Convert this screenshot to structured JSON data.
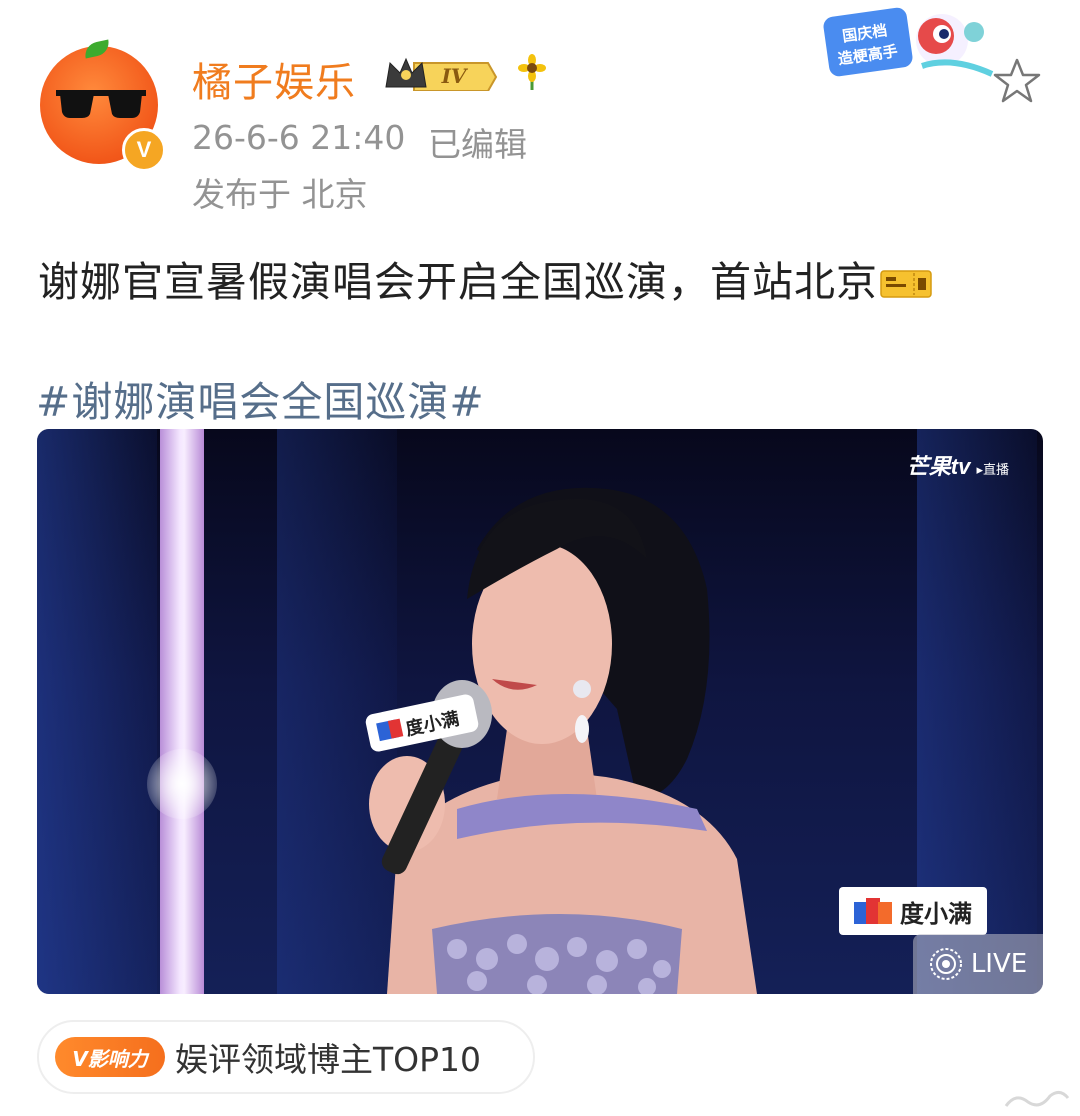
{
  "author": {
    "name": "橘子娱乐",
    "level_badge": "IV",
    "verified_mark": "V",
    "timestamp": "26-6-6 21:40",
    "edited": "已编辑",
    "location": "发布于 北京"
  },
  "promo_badge": {
    "line1": "国庆档",
    "line2": "造梗高手"
  },
  "post": {
    "text": "谢娜官宣暑假演唱会开启全国巡演，首站北京",
    "hashtag": "#谢娜演唱会全国巡演#"
  },
  "media": {
    "watermark": "芒果tv",
    "watermark_sub": "▸直播",
    "mic_label": "度小满",
    "sponsor": "度小满",
    "live_label": "LIVE"
  },
  "influence": {
    "badge": "V影响力",
    "text": "娱评领域博主TOP10"
  },
  "colors": {
    "username": "#f07c1e",
    "meta": "#939393",
    "hashtag": "#566e8a",
    "badge_orange": "#f56f1d"
  },
  "icons": [
    "avatar-orange-sunglasses",
    "verified-v-icon",
    "crown-level-icon",
    "sunflower-icon",
    "star-icon",
    "ticket-icon",
    "live-icon"
  ]
}
